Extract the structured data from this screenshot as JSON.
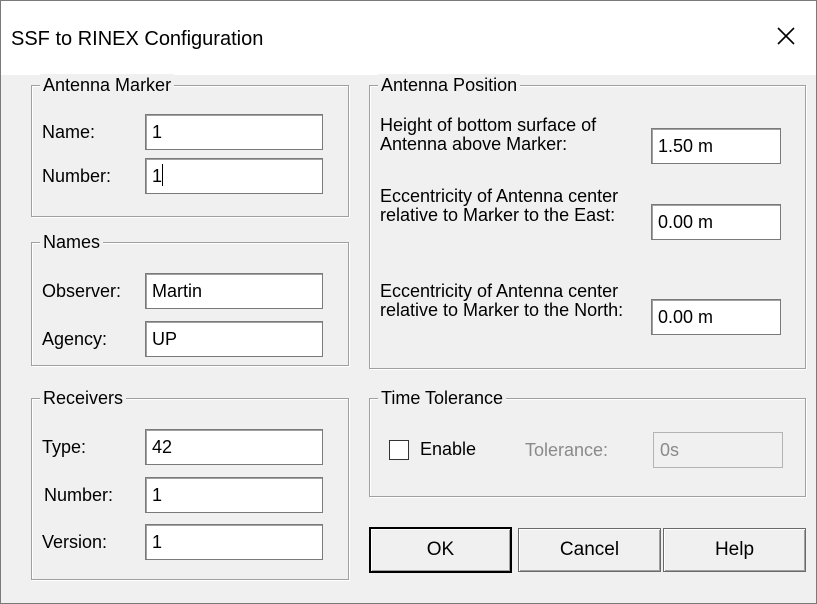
{
  "window": {
    "title": "SSF to RINEX Configuration",
    "close_glyph": "✕"
  },
  "antenna_marker": {
    "legend": "Antenna Marker",
    "name_label": "Name:",
    "name_value": "1",
    "number_label": "Number:",
    "number_value": "1"
  },
  "names": {
    "legend": "Names",
    "observer_label": "Observer:",
    "observer_value": "Martin",
    "agency_label": "Agency:",
    "agency_value": "UP"
  },
  "receivers": {
    "legend": "Receivers",
    "type_label": "Type:",
    "type_value": "42",
    "number_label": "Number:",
    "number_value": "1",
    "version_label": "Version:",
    "version_value": "1"
  },
  "antenna_position": {
    "legend": "Antenna Position",
    "height_label": "Height of bottom surface of Antenna above Marker:",
    "height_value": "1.50 m",
    "east_label": "Eccentricity of Antenna center relative to Marker to the East:",
    "east_value": "0.00 m",
    "north_label": "Eccentricity of Antenna center relative to Marker to the North:",
    "north_value": "0.00 m"
  },
  "time_tolerance": {
    "legend": "Time Tolerance",
    "enable_label": "Enable",
    "enable_checked": false,
    "tolerance_label": "Tolerance:",
    "tolerance_value": "0s"
  },
  "buttons": {
    "ok": "OK",
    "cancel": "Cancel",
    "help": "Help"
  }
}
